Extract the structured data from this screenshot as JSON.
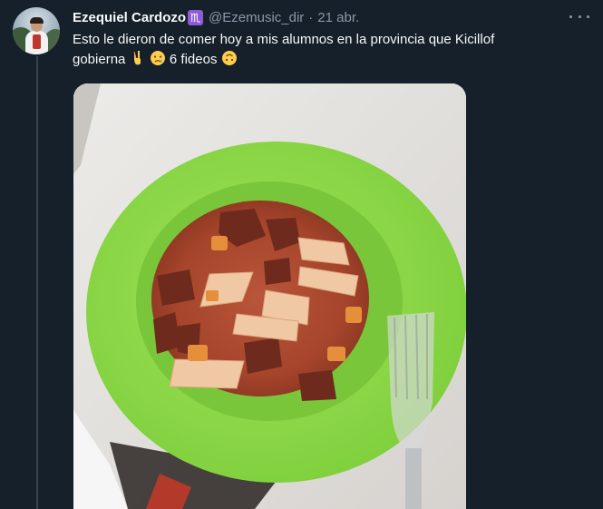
{
  "tweet": {
    "author_name": "Ezequiel Cardozo",
    "zodiac_badge": "♏",
    "handle": "@Ezemusic_dir",
    "separator": "·",
    "date": "21 abr.",
    "text_line1": "Esto le dieron de comer hoy a mis alumnos en la provincia que Kicillof",
    "text_line2_prefix": "gobierna",
    "text_line2_number": "6 fideos",
    "emojis": [
      "victory-hand",
      "crying-face",
      "upside-down-face"
    ]
  },
  "colors": {
    "background": "#15202b",
    "text_primary": "#f7f9f9",
    "text_secondary": "#8b98a5",
    "plate_green": "#8ed84a",
    "stew": "#a9482f"
  }
}
